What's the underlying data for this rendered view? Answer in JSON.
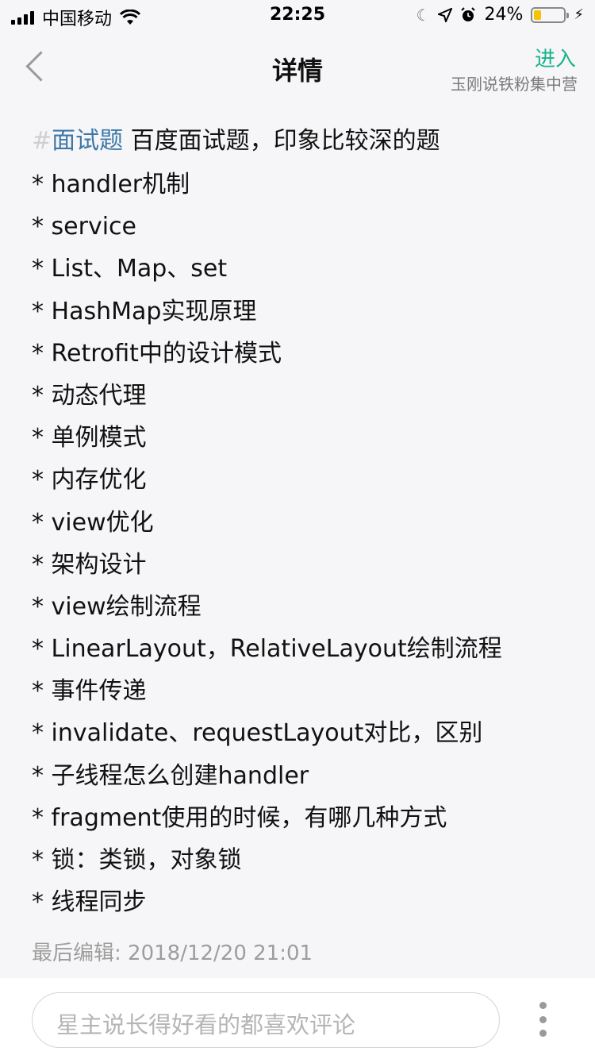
{
  "status_bar": {
    "carrier": "中国移动",
    "time": "22:25",
    "battery_text": "24%",
    "battery_level": 0.24,
    "battery_color": "#f7c300"
  },
  "nav": {
    "title": "详情",
    "enter_label": "进入",
    "group_name": "玉刚说铁粉集中营",
    "accent_color": "#19b38c"
  },
  "post": {
    "hash_sign": "#",
    "topic": "面试题",
    "title": " 百度面试题，印象比较深的题",
    "lines": [
      "* handler机制",
      "* service",
      "* List、Map、set",
      "* HashMap实现原理",
      "* Retrofit中的设计模式",
      "* 动态代理",
      "* 单例模式",
      "* 内存优化",
      "* view优化",
      "* 架构设计",
      "* view绘制流程",
      "* LinearLayout，RelativeLayout绘制流程",
      "* 事件传递",
      "* invalidate、requestLayout对比，区别",
      "* 子线程怎么创建handler",
      "* fragment使用的时候，有哪几种方式",
      "* 锁：类锁，对象锁",
      "* 线程同步"
    ],
    "edit_time": "最后编辑: 2018/12/20 21:01"
  },
  "bottom": {
    "comment_placeholder": "星主说长得好看的都喜欢评论",
    "more_icon": "more-vertical-icon"
  }
}
